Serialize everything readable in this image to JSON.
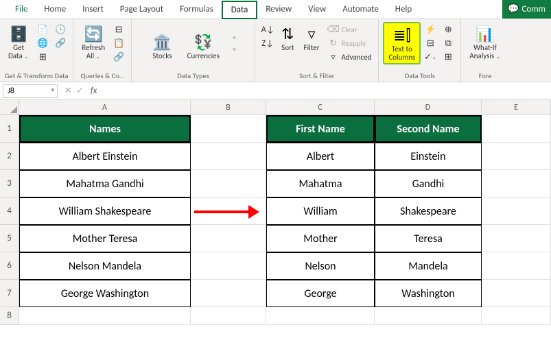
{
  "tabs": {
    "file": "File",
    "home": "Home",
    "insert": "Insert",
    "page_layout": "Page Layout",
    "formulas": "Formulas",
    "data": "Data",
    "review": "Review",
    "view": "View",
    "automate": "Automate",
    "help": "Help",
    "comments": "Comm"
  },
  "ribbon": {
    "get_data": "Get\nData",
    "refresh_all": "Refresh\nAll",
    "stocks": "Stocks",
    "currencies": "Currencies",
    "sort": "Sort",
    "filter": "Filter",
    "clear": "Clear",
    "reapply": "Reapply",
    "advanced": "Advanced",
    "text_to_columns": "Text to\nColumns",
    "whatif": "What-If\nAnalysis",
    "groups": {
      "get_transform": "Get & Transform Data",
      "queries": "Queries & Co…",
      "data_types": "Data Types",
      "sort_filter": "Sort & Filter",
      "data_tools": "Data Tools",
      "forecast": "Fore"
    }
  },
  "formula_bar": {
    "name_box": "J8",
    "fx": "fx",
    "value": ""
  },
  "columns": [
    "A",
    "B",
    "C",
    "D",
    "E"
  ],
  "rows": [
    "1",
    "2",
    "3",
    "4",
    "5",
    "6",
    "7",
    "8"
  ],
  "headers": {
    "names": "Names",
    "first": "First Name",
    "second": "Second Name"
  },
  "data": {
    "names": [
      "Albert Einstein",
      "Mahatma Gandhi",
      "William Shakespeare",
      "Mother Teresa",
      "Nelson Mandela",
      "George Washington"
    ],
    "first": [
      "Albert",
      "Mahatma",
      "William",
      "Mother",
      "Nelson",
      "George"
    ],
    "second": [
      "Einstein",
      "Gandhi",
      "Shakespeare",
      "Teresa",
      "Mandela",
      "Washington"
    ]
  }
}
